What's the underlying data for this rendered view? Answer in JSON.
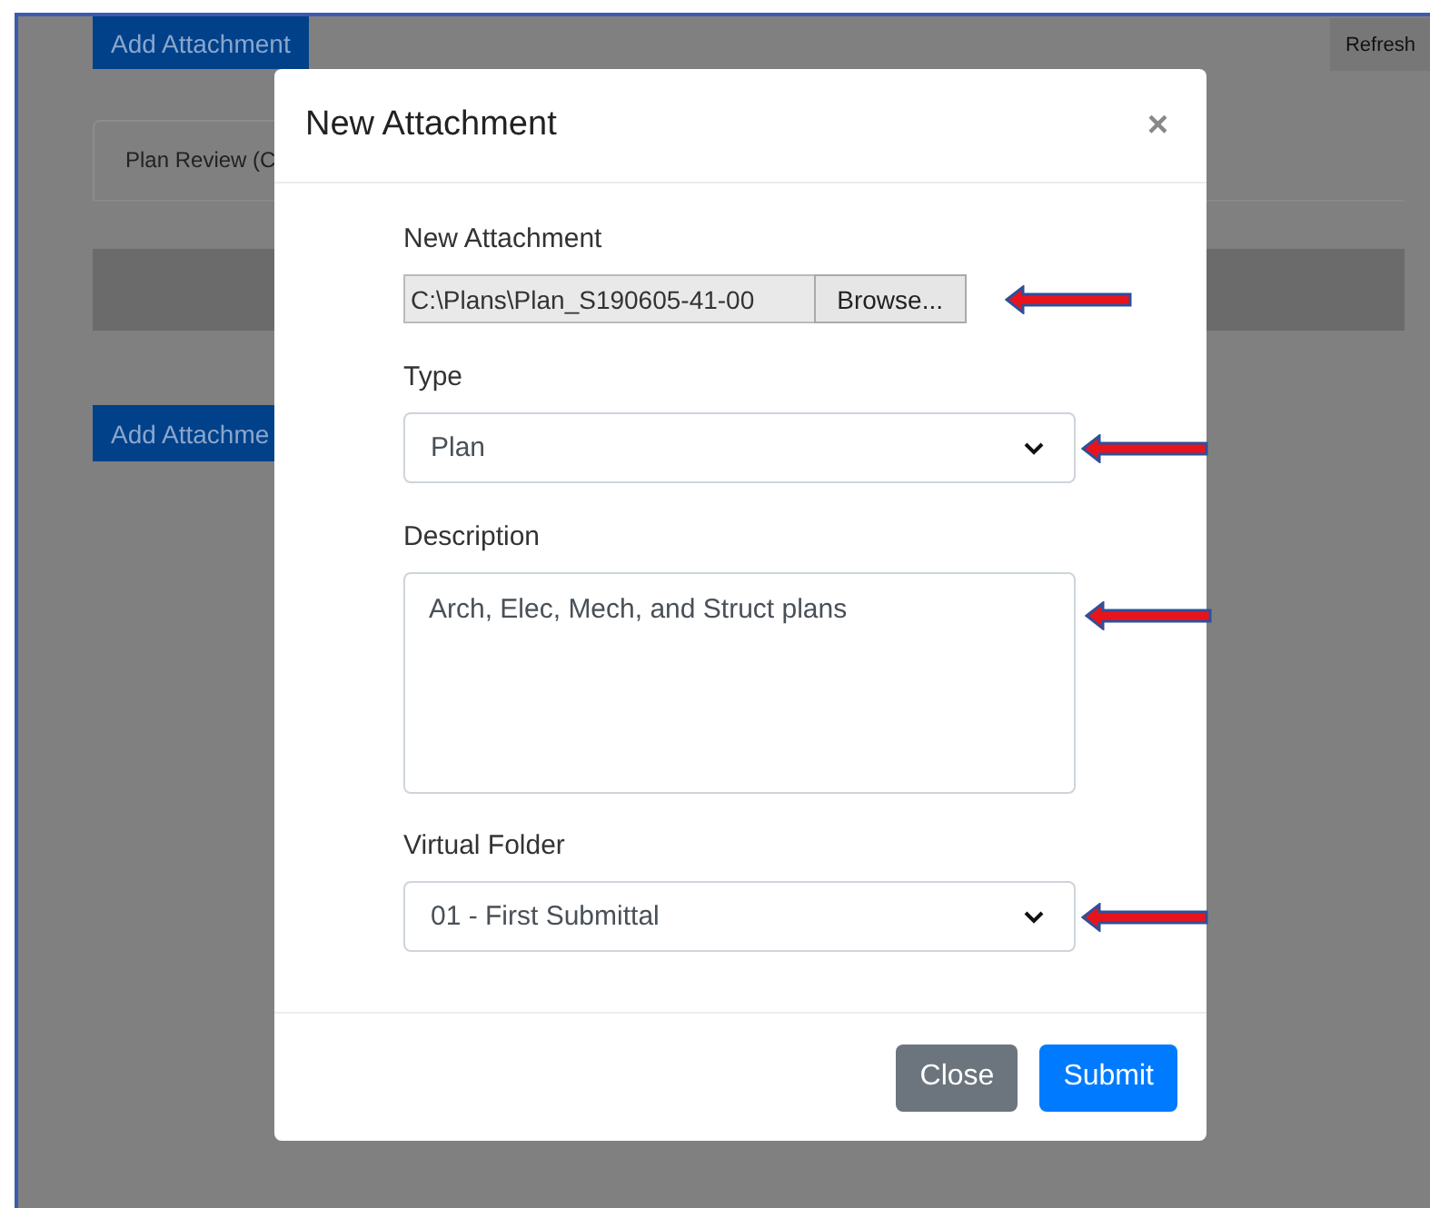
{
  "page": {
    "top_button": "Add Attachment",
    "refresh_button": "Refresh",
    "tab": "Plan Review (C",
    "bottom_button": "Add Attachme"
  },
  "modal": {
    "title": "New Attachment",
    "close": "×",
    "fields": [
      {
        "kind": "file",
        "label": "New Attachment",
        "value": "C:\\Plans\\Plan_S190605-41-00",
        "button": "Browse...",
        "annotated": true
      },
      {
        "kind": "select",
        "label": "Type",
        "value": "Plan",
        "annotated": true
      },
      {
        "kind": "textarea",
        "label": "Description",
        "value": "Arch, Elec, Mech, and Struct plans",
        "annotated": true
      },
      {
        "kind": "select",
        "label": "Virtual Folder",
        "value": "01 - First Submittal",
        "annotated": true
      }
    ],
    "buttons": [
      {
        "label": "Close",
        "kind": "secondary"
      },
      {
        "label": "Submit",
        "kind": "primary"
      }
    ]
  }
}
